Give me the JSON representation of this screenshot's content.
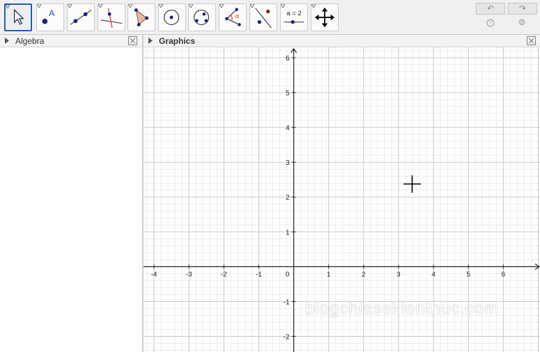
{
  "toolbar": {
    "tools": [
      {
        "name": "move-tool",
        "icon": "arrow-cursor-icon",
        "active": true
      },
      {
        "name": "point-tool",
        "icon": "point-a-icon",
        "label": "A"
      },
      {
        "name": "line-tool",
        "icon": "line-through-points-icon"
      },
      {
        "name": "perpendicular-tool",
        "icon": "perpendicular-line-icon"
      },
      {
        "name": "polygon-tool",
        "icon": "polygon-icon"
      },
      {
        "name": "circle-center-tool",
        "icon": "circle-center-point-icon"
      },
      {
        "name": "circle-three-points-tool",
        "icon": "circle-three-points-icon"
      },
      {
        "name": "angle-tool",
        "icon": "angle-icon",
        "label": "α"
      },
      {
        "name": "reflect-tool",
        "icon": "reflect-line-icon"
      },
      {
        "name": "slider-tool",
        "icon": "slider-icon",
        "label": "a = 2"
      },
      {
        "name": "move-view-tool",
        "icon": "move-graphics-view-icon"
      }
    ],
    "undo_glyph": "↶",
    "redo_glyph": "↷",
    "help_glyph": "?",
    "settings_glyph": "⚙"
  },
  "algebra_panel": {
    "title": "Algebra"
  },
  "graphics_panel": {
    "title": "Graphics"
  },
  "graph": {
    "x_ticks": [
      "-4",
      "-3",
      "-2",
      "-1",
      "0",
      "1",
      "2",
      "3",
      "4",
      "5",
      "6"
    ],
    "y_ticks": [
      "6",
      "5",
      "4",
      "3",
      "2",
      "1",
      "-1",
      "-2"
    ],
    "x_range": [
      -4.3,
      7.05
    ],
    "y_range": [
      -2.45,
      6.3
    ]
  },
  "watermark": "blogchiasekienthuc.com",
  "colors": {
    "accent": "#1c5bb5",
    "point": "#1a237e",
    "grid_major": "#c8c8c8",
    "grid_minor": "#ececec",
    "red": "#d32f2f"
  }
}
